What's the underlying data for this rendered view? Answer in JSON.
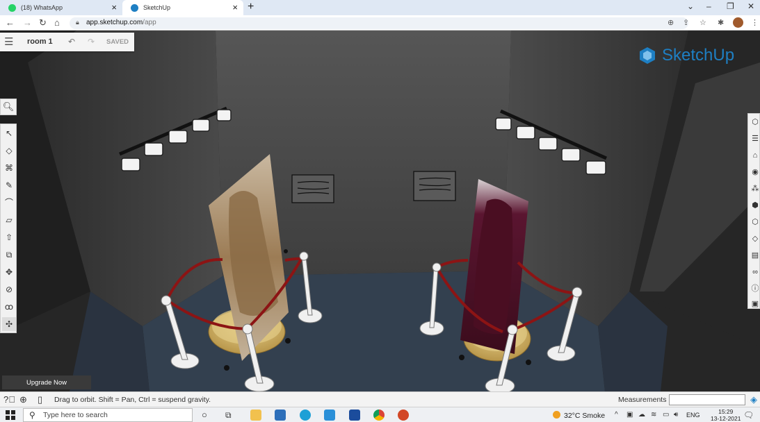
{
  "browser": {
    "tabs": [
      {
        "label": "(18) WhatsApp",
        "color": "#25d366"
      },
      {
        "label": "SketchUp",
        "color": "#1e7fc3"
      }
    ],
    "url_host": "app.sketchup.com",
    "url_path": "/app"
  },
  "app": {
    "model_name": "room 1",
    "saved_label": "SAVED",
    "brand": "SketchUp",
    "upgrade_label": "Upgrade Now",
    "left_tools": [
      "select-icon",
      "eraser-icon",
      "paint-bucket-icon",
      "pencil-icon",
      "arc-icon",
      "rectangle-icon",
      "push-pull-icon",
      "offset-icon",
      "move-icon",
      "rotate-icon",
      "tape-measure-icon",
      "orbit-icon"
    ],
    "right_tools": [
      "views-icon",
      "layers-icon",
      "materials-icon",
      "components-icon",
      "scenes-icon",
      "outliner-icon",
      "solid-tools-icon",
      "tags-icon",
      "styles-icon",
      "display-icon",
      "entity-info-icon",
      "instructor-icon"
    ]
  },
  "statusbar": {
    "hint": "Drag to orbit. Shift = Pan, Ctrl = suspend gravity.",
    "measurements_label": "Measurements",
    "measurements_value": ""
  },
  "taskbar": {
    "search_placeholder": "Type here to search",
    "weather": "32°C  Smoke",
    "language": "ENG",
    "time": "15:29",
    "date": "13-12-2021"
  },
  "colors": {
    "accent": "#1e7fc3",
    "rope": "#8c1414",
    "floor": "#33404f"
  }
}
